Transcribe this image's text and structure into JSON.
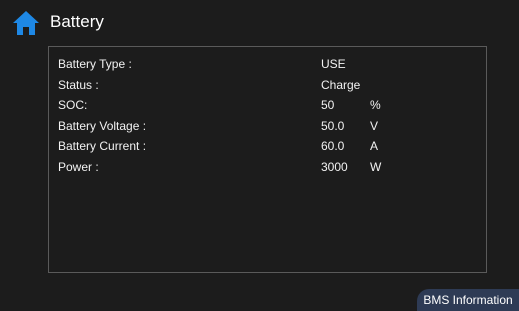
{
  "header": {
    "home_icon": "home-icon",
    "home_icon_color": "#1e88e5",
    "title": "Battery"
  },
  "battery_info": {
    "rows": [
      {
        "label": "Battery Type :",
        "value": "USE",
        "unit": ""
      },
      {
        "label": "Status :",
        "value": "Charge",
        "unit": ""
      },
      {
        "label": "SOC:",
        "value": "50",
        "unit": "%"
      },
      {
        "label": "Battery Voltage :",
        "value": "50.0",
        "unit": "V"
      },
      {
        "label": "Battery Current :",
        "value": "60.0",
        "unit": "A"
      },
      {
        "label": "Power :",
        "value": "3000",
        "unit": "W"
      }
    ]
  },
  "footer": {
    "bms_button_label": "BMS Information"
  },
  "colors": {
    "background": "#1c1c1c",
    "panel_border": "#5a5a5a",
    "text": "#f2f2f2",
    "button_background": "#2e3b55"
  }
}
